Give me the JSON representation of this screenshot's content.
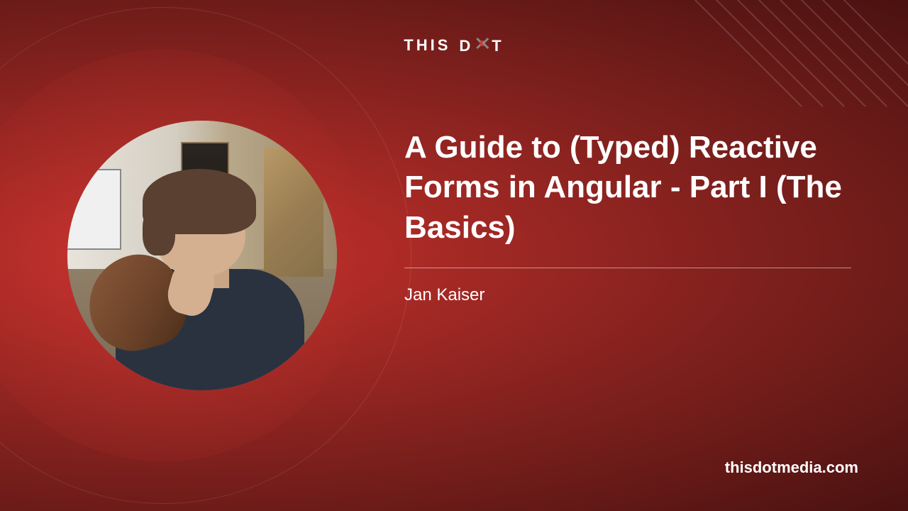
{
  "logo": {
    "text_left": "THIS",
    "text_right": "D",
    "text_end": "T"
  },
  "article": {
    "title": "A Guide to (Typed) Reactive Forms in Angular - Part I (The Basics)",
    "author": "Jan Kaiser"
  },
  "footer": {
    "url": "thisdotmedia.com"
  },
  "colors": {
    "background_primary": "#a02824",
    "background_dark": "#4a1210",
    "text": "#ffffff",
    "accent": "#d43530"
  }
}
